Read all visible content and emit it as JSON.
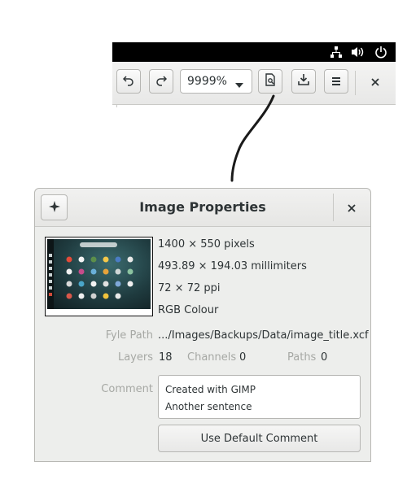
{
  "system_tray": {
    "icons": [
      "network-icon",
      "volume-icon",
      "power-icon"
    ]
  },
  "toolbar": {
    "zoom_value": "9999%",
    "buttons": [
      "undo-icon",
      "redo-icon",
      "image-properties-icon",
      "download-icon",
      "menu-icon",
      "close-icon"
    ]
  },
  "dialog": {
    "title": "Image Properties",
    "dimensions_pixels": "1400 × 550 pixels",
    "dimensions_mm": "493.89 × 194.03 millimiters",
    "resolution": "72 × 72 ppi",
    "color_mode": "RGB Colour",
    "file_path_label": "Fyle Path",
    "file_path_value": ".../Images/Backups/Data/image_title.xcf",
    "layers_label": "Layers",
    "layers_value": "18",
    "channels_label": "Channels",
    "channels_value": "0",
    "paths_label": "Paths",
    "paths_value": "0",
    "comment_label": "Comment",
    "comment_lines": [
      "Created with GIMP",
      "Another sentence"
    ],
    "default_comment_button": "Use Default Comment"
  },
  "colors": {
    "topbar": "#000000",
    "dialog_bg": "#edeeec",
    "dim_label": "#a6a8a4",
    "text": "#2e3436"
  }
}
